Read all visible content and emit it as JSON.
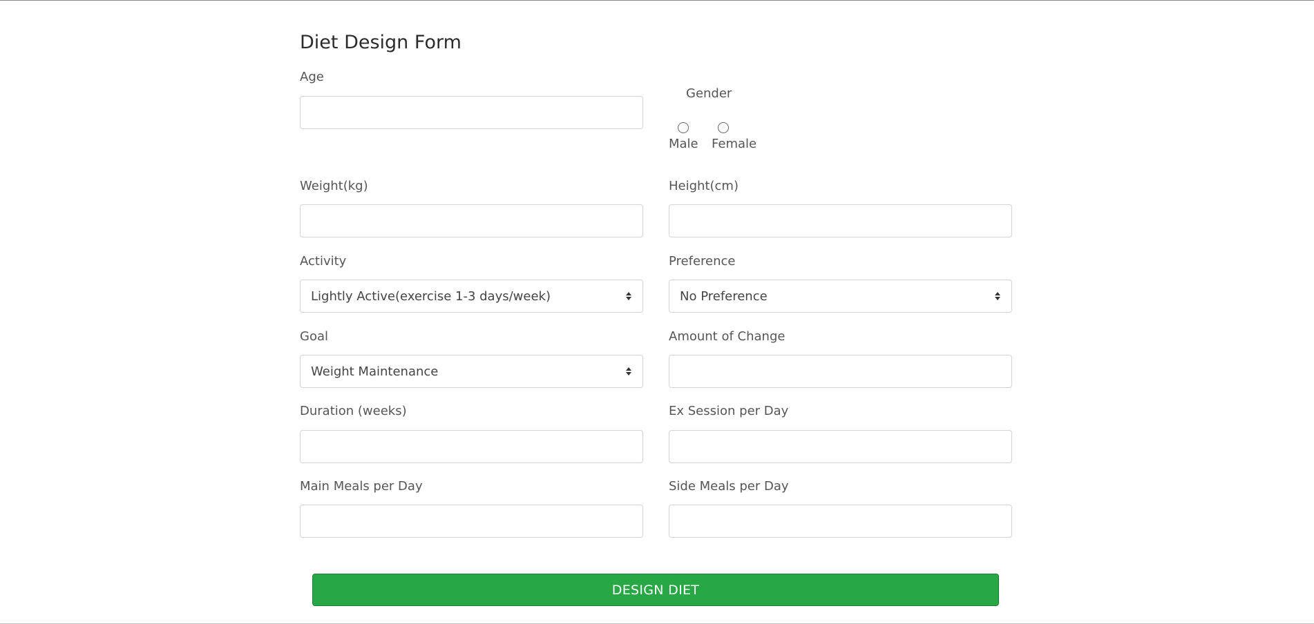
{
  "form": {
    "title": "Diet Design Form",
    "age": {
      "label": "Age",
      "value": "",
      "placeholder": ""
    },
    "gender": {
      "label": "Gender",
      "options": [
        "Male",
        "Female"
      ],
      "selected": null
    },
    "weight": {
      "label": "Weight(kg)",
      "value": "",
      "placeholder": ""
    },
    "height": {
      "label": "Height(cm)",
      "value": "",
      "placeholder": ""
    },
    "activity": {
      "label": "Activity",
      "selected": "Lightly Active(exercise 1-3 days/week)"
    },
    "preference": {
      "label": "Preference",
      "selected": "No Preference"
    },
    "goal": {
      "label": "Goal",
      "selected": "Weight Maintenance"
    },
    "amount_of_change": {
      "label": "Amount of Change",
      "value": "",
      "placeholder": ""
    },
    "duration": {
      "label": "Duration (weeks)",
      "value": "",
      "placeholder": ""
    },
    "ex_session": {
      "label": "Ex Session per Day",
      "value": "",
      "placeholder": ""
    },
    "main_meals": {
      "label": "Main Meals per Day",
      "value": "",
      "placeholder": ""
    },
    "side_meals": {
      "label": "Side Meals per Day",
      "value": "",
      "placeholder": ""
    },
    "submit_label": "DESIGN DIET"
  },
  "colors": {
    "submit_bg": "#28a745",
    "submit_border": "#1e7e34",
    "input_border": "#cfd4d9",
    "label_text": "#555555",
    "title_text": "#2b2b2b"
  },
  "icons": {
    "select_caret": "select-caret-icon"
  }
}
